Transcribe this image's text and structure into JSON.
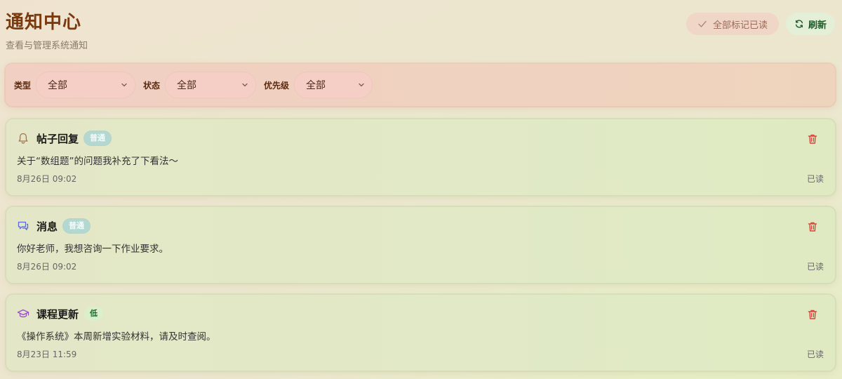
{
  "header": {
    "title": "通知中心",
    "subtitle": "查看与管理系统通知"
  },
  "actions": {
    "mark_all_read": "全部标记已读",
    "refresh": "刷新"
  },
  "filters": [
    {
      "label": "类型",
      "value": "全部"
    },
    {
      "label": "状态",
      "value": "全部"
    },
    {
      "label": "优先级",
      "value": "全部"
    }
  ],
  "notifications": [
    {
      "icon": "bell-icon",
      "title": "帖子回复",
      "priority": "普通",
      "body": "关于“数组题”的问题我补充了下看法～",
      "time": "8月26日 09:02",
      "status": "已读"
    },
    {
      "icon": "chat-icon",
      "title": "消息",
      "priority": "普通",
      "body": "你好老师，我想咨询一下作业要求。",
      "time": "8月26日 09:02",
      "status": "已读"
    },
    {
      "icon": "graduation-cap-icon",
      "title": "课程更新",
      "priority": "低",
      "body": "《操作系统》本周新增实验材料，请及时查阅。",
      "time": "8月23日 11:59",
      "status": "已读"
    }
  ],
  "colors": {
    "title": "#7a3a10",
    "delete": "#d9443a",
    "refresh": "#1f5a2a"
  }
}
